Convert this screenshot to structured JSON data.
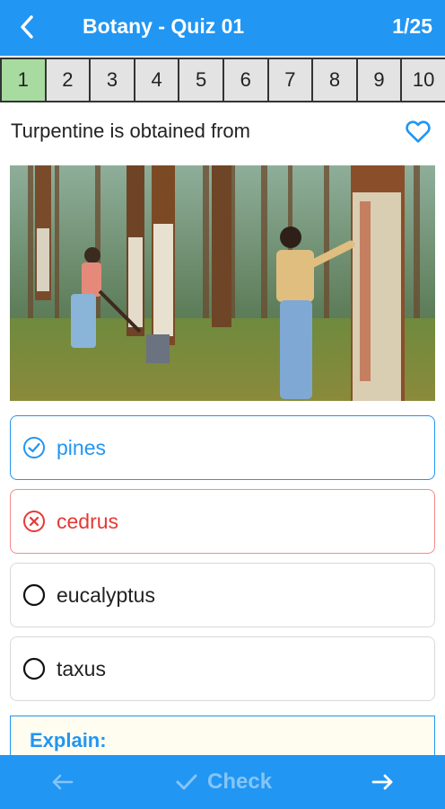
{
  "header": {
    "title": "Botany - Quiz 01",
    "counter": "1/25",
    "back_icon": "chevron-left-icon"
  },
  "question_nav": {
    "items": [
      "1",
      "2",
      "3",
      "4",
      "5",
      "6",
      "7",
      "8",
      "9",
      "10"
    ],
    "active_index": 0
  },
  "question": {
    "text": "Turpentine is obtained from",
    "favorite_icon": "heart-outline-icon"
  },
  "image": {
    "semantic": "photo-pine-tapping"
  },
  "options": [
    {
      "label": "pines",
      "state": "correct",
      "icon": "check-circle-icon"
    },
    {
      "label": "cedrus",
      "state": "wrong",
      "icon": "x-circle-icon"
    },
    {
      "label": "eucalyptus",
      "state": "none",
      "icon": "radio-empty-icon"
    },
    {
      "label": "taxus",
      "state": "none",
      "icon": "radio-empty-icon"
    }
  ],
  "explain": {
    "label": "Explain:"
  },
  "bottom_bar": {
    "check_label": "Check",
    "prev_icon": "arrow-left-icon",
    "next_icon": "arrow-right-icon"
  },
  "colors": {
    "primary": "#2196F3",
    "correct": "#2196F3",
    "wrong": "#E53935",
    "active_question": "#A8DBA0",
    "explain_bg": "#FFFDF0"
  }
}
